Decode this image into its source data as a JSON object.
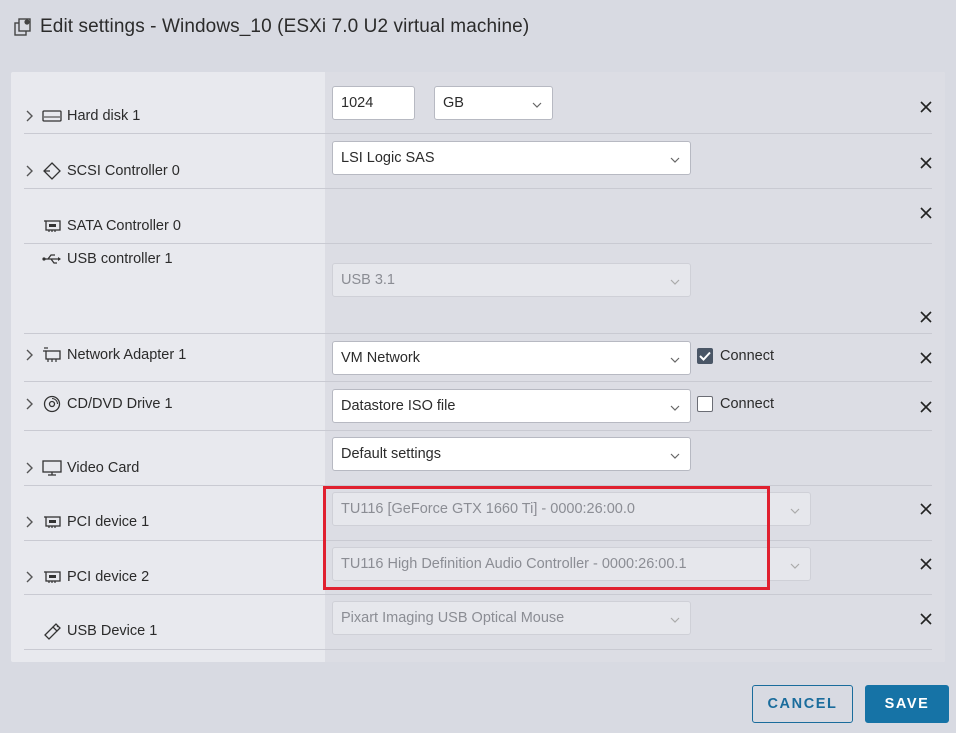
{
  "dialog": {
    "title": "Edit settings - Windows_10 (ESXi 7.0 U2 virtual machine)",
    "icon": "vm-settings-icon"
  },
  "devices": [
    {
      "label": "Hard disk 1",
      "icon": "hard-disk-icon",
      "expandable": true,
      "size_value": "1024",
      "size_unit": "GB"
    },
    {
      "label": "SCSI Controller 0",
      "icon": "scsi-controller-icon",
      "expandable": true,
      "value": "LSI Logic SAS"
    },
    {
      "label": "SATA Controller 0",
      "icon": "sata-controller-icon",
      "expandable": false
    },
    {
      "label": "USB controller 1",
      "icon": "usb-icon",
      "expandable": false,
      "value": "USB 3.1",
      "disabled": true
    },
    {
      "label": "Network Adapter 1",
      "icon": "network-adapter-icon",
      "expandable": true,
      "value": "VM Network",
      "connect_label": "Connect",
      "connect_checked": true
    },
    {
      "label": "CD/DVD Drive 1",
      "icon": "cd-dvd-icon",
      "expandable": true,
      "value": "Datastore ISO file",
      "connect_label": "Connect",
      "connect_checked": false
    },
    {
      "label": "Video Card",
      "icon": "monitor-icon",
      "expandable": true,
      "value": "Default settings"
    },
    {
      "label": "PCI device 1",
      "icon": "pci-device-icon",
      "expandable": true,
      "value": "TU116 [GeForce GTX 1660 Ti] - 0000:26:00.0",
      "disabled": true
    },
    {
      "label": "PCI device 2",
      "icon": "pci-device-icon",
      "expandable": true,
      "value": "TU116 High Definition Audio Controller - 0000:26:00.1",
      "disabled": true
    },
    {
      "label": "USB Device 1",
      "icon": "usb-device-icon",
      "expandable": false,
      "value": "Pixart Imaging USB Optical Mouse",
      "disabled": true
    }
  ],
  "footer": {
    "cancel_label": "CANCEL",
    "save_label": "SAVE"
  },
  "colors": {
    "accent": "#1673a6",
    "highlight": "#e0202f"
  }
}
